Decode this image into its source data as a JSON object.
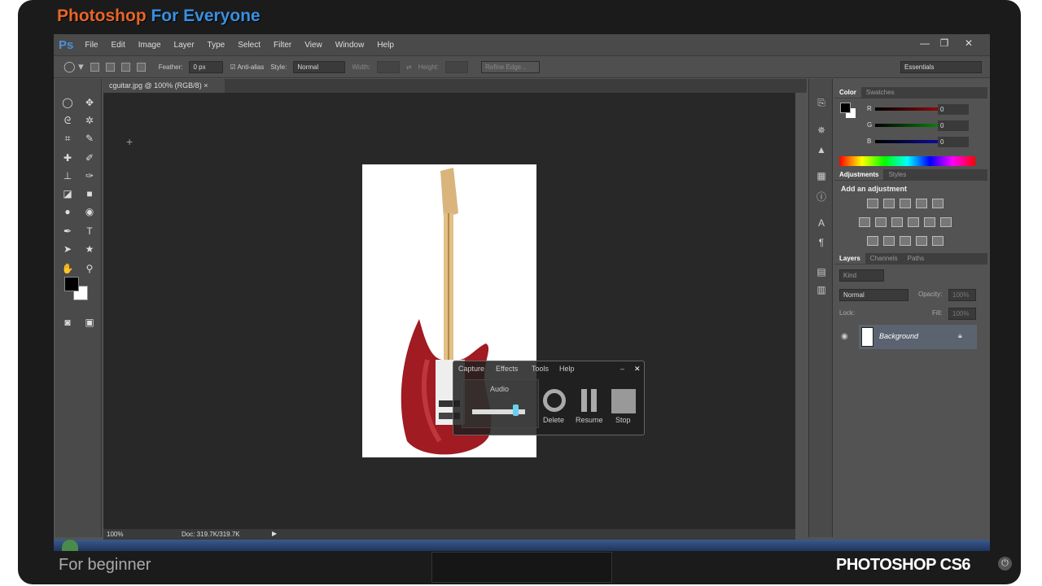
{
  "branding": {
    "title_main": "Photoshop ",
    "title_accent": "For Everyone",
    "footer_left": "For beginner",
    "footer_right": "PHOTOSHOP CS6"
  },
  "app": {
    "logo": "Ps",
    "menus": [
      "File",
      "Edit",
      "Image",
      "Layer",
      "Type",
      "Select",
      "Filter",
      "View",
      "Window",
      "Help"
    ]
  },
  "window_controls": {
    "minimize": "—",
    "restore": "❐",
    "close": "✕"
  },
  "options_bar": {
    "feather_label": "Feather:",
    "feather_value": "0 px",
    "antialias_label": "Anti-alias",
    "antialias_checked": true,
    "style_label": "Style:",
    "style_value": "Normal",
    "width_label": "Width:",
    "height_label": "Height:",
    "refine_edge": "Refine Edge...",
    "workspace": "Essentials"
  },
  "document": {
    "tab_title": "cguitar.jpg @ 100% (RGB/8)",
    "tab_close": "×"
  },
  "status_bar": {
    "zoom": "100%",
    "doc_info": "Doc: 319.7K/319.7K"
  },
  "color_panel": {
    "tabs": [
      "Color",
      "Swatches"
    ],
    "channels": [
      {
        "label": "R",
        "value": "0",
        "color": "#d01010"
      },
      {
        "label": "G",
        "value": "0",
        "color": "#10c010"
      },
      {
        "label": "B",
        "value": "0",
        "color": "#1010e0"
      }
    ]
  },
  "adjustments_panel": {
    "tabs": [
      "Adjustments",
      "Styles"
    ],
    "heading": "Add an adjustment"
  },
  "layers_panel": {
    "tabs": [
      "Layers",
      "Channels",
      "Paths"
    ],
    "filter": "Kind",
    "blend_mode": "Normal",
    "opacity_label": "Opacity:",
    "opacity_value": "100%",
    "lock_label": "Lock:",
    "fill_label": "Fill:",
    "fill_value": "100%",
    "layers": [
      {
        "name": "Background",
        "locked": true,
        "visible": true
      }
    ]
  },
  "recorder": {
    "menus": [
      "Capture",
      "Effects",
      "Tools",
      "Help"
    ],
    "audio_label": "Audio",
    "audio_level": 0.8,
    "buttons": [
      "Delete",
      "Resume",
      "Stop"
    ],
    "minimize": "–",
    "close": "✕"
  },
  "colors": {
    "accent_orange": "#e8652a",
    "accent_blue": "#3a8fe0",
    "ps_bg": "#535353",
    "canvas_bg": "#282828"
  }
}
